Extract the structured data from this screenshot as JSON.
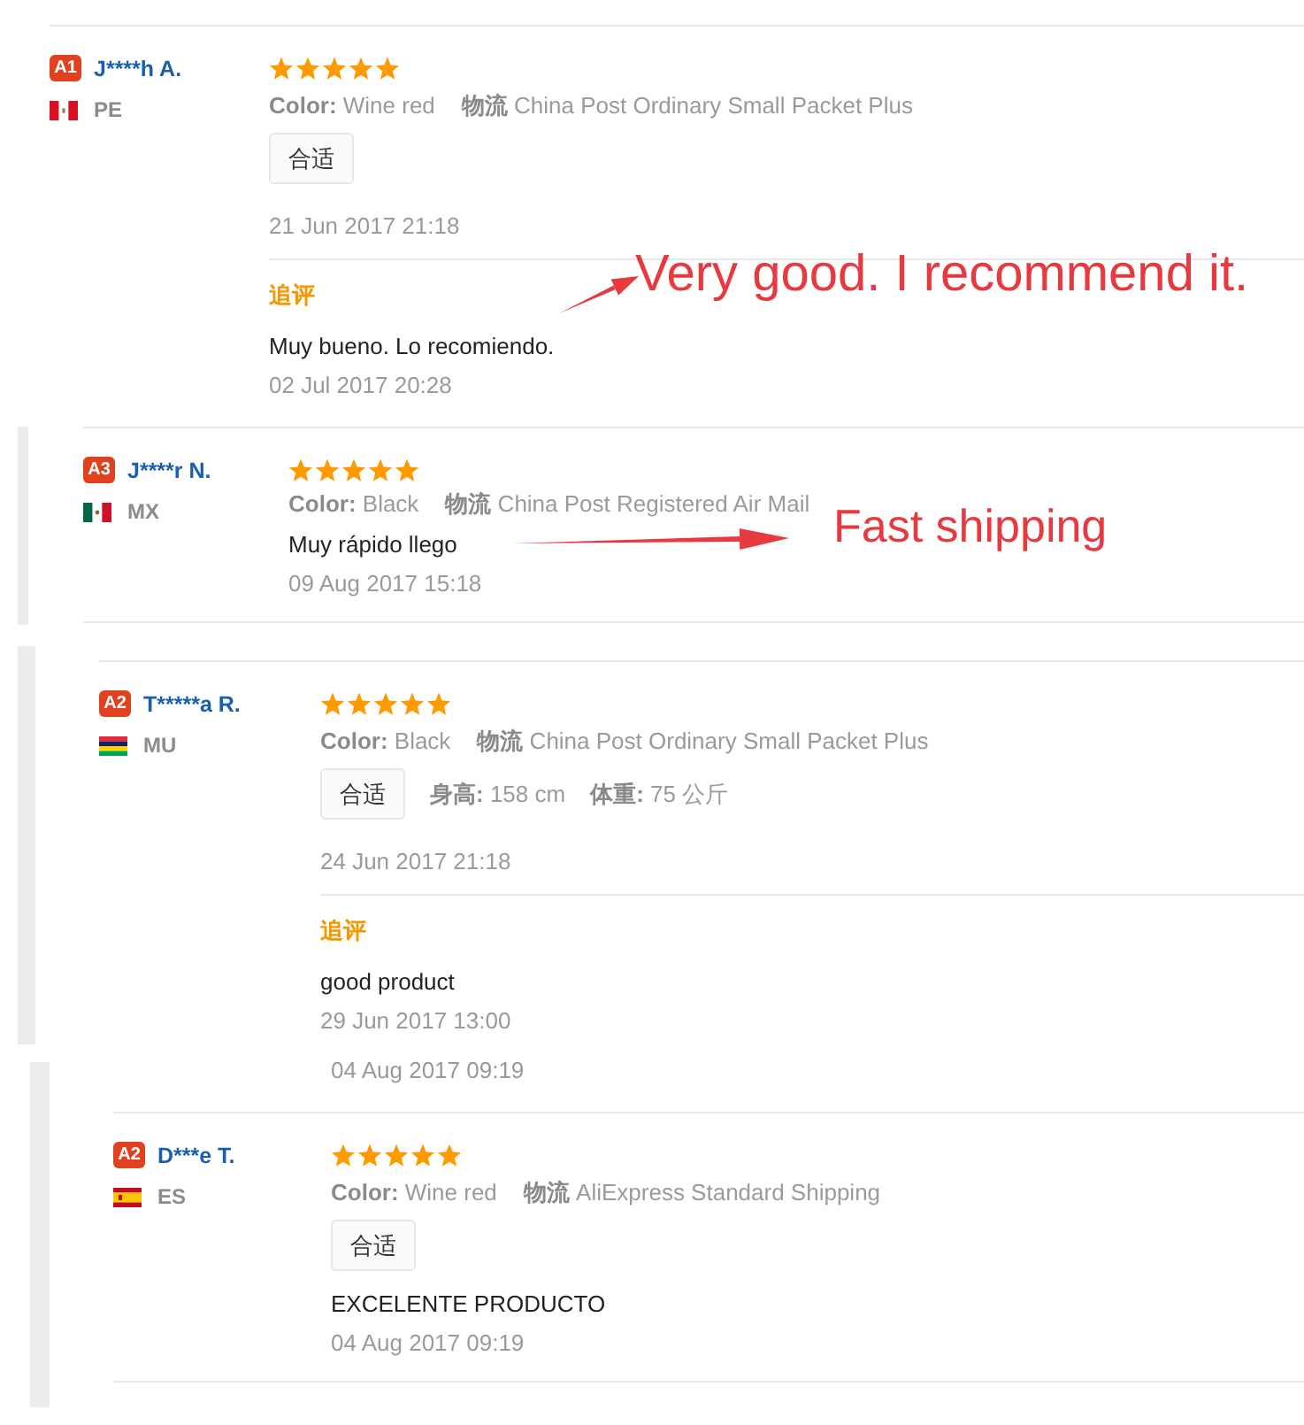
{
  "reviews": [
    {
      "badge": "A1",
      "name": "J****h A.",
      "flag": {
        "kind": "peru"
      },
      "country": "PE",
      "stars": 5,
      "attributes": [
        "**Color:** Wine red",
        "**物流** China Post Ordinary Small Packet Plus"
      ],
      "tag": "合适",
      "date": "21 Jun 2017 21:18",
      "follow_up": {
        "label": "追评",
        "text": "Muy bueno. Lo recomiendo.",
        "date": "02 Jul 2017 20:28"
      },
      "annotation": {
        "text": "Very good. I recommend it."
      }
    },
    {
      "badge": "A3",
      "name": "J****r N.",
      "flag": {
        "kind": "mexico"
      },
      "country": "MX",
      "stars": 5,
      "attributes": [
        "**Color:** Black",
        "**物流** China Post Registered Air Mail"
      ],
      "text": "Muy rápido llego",
      "date": "09 Aug 2017 15:18",
      "annotation": {
        "text": "Fast shipping"
      }
    },
    {
      "badge": "A2",
      "name": "T*****a R.",
      "flag": {
        "kind": "mauritius"
      },
      "country": "MU",
      "stars": 5,
      "attributes": [
        "**Color:** Black",
        "**物流** China Post Ordinary Small Packet Plus"
      ],
      "tag": "合适",
      "measurements": [
        "**身高:** 158 cm",
        "**体重:** 75 公斤"
      ],
      "date": "24 Jun 2017 21:18",
      "follow_up": {
        "label": "追评",
        "text": "good product",
        "date": "29 Jun 2017 13:00"
      }
    },
    {
      "leading_date": "04 Aug 2017 09:19",
      "badge": "A2",
      "name": "D***e T.",
      "flag": {
        "kind": "spain"
      },
      "country": "ES",
      "stars": 5,
      "attributes": [
        "**Color:** Wine red",
        "**物流** AliExpress Standard Shipping"
      ],
      "tag": "合适",
      "text": "EXCELENTE PRODUCTO",
      "date": "04 Aug 2017 09:19"
    }
  ]
}
